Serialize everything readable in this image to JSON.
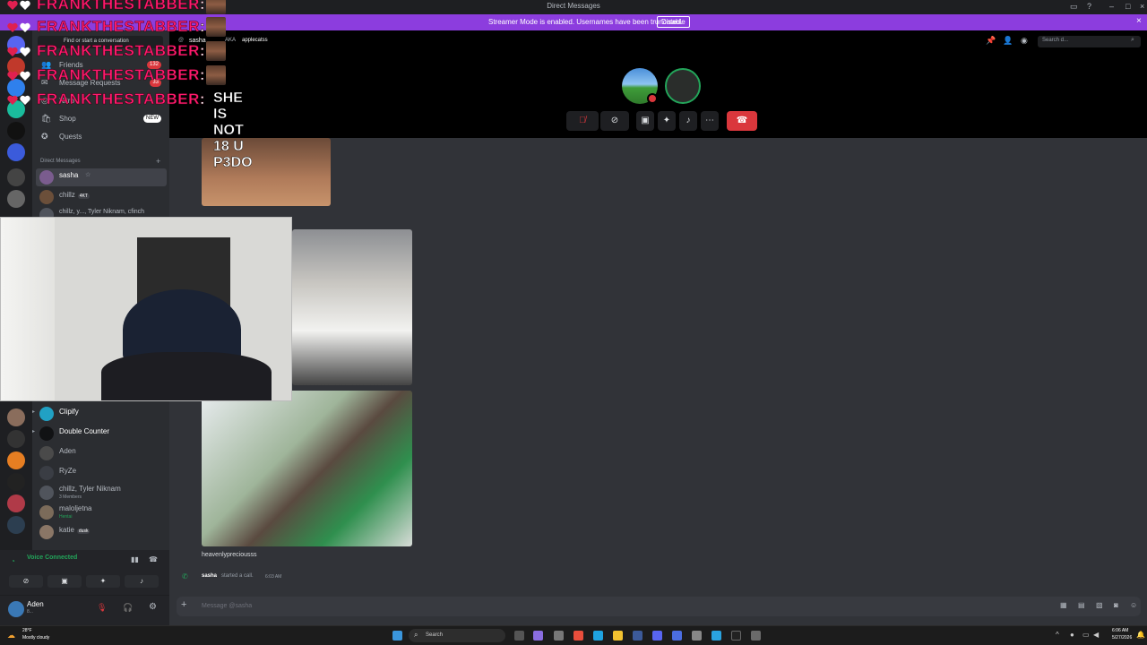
{
  "window": {
    "title": "Direct Messages"
  },
  "banner": {
    "message": "Streamer Mode is enabled. Usernames have been truncated.",
    "disable_label": "Disable"
  },
  "sidebar": {
    "find_placeholder": "Find or start a conversation",
    "nav": [
      {
        "label": "Friends",
        "badge": "132"
      },
      {
        "label": "Message Requests",
        "badge": "33"
      },
      {
        "label": "Nitro",
        "badge": ""
      },
      {
        "label": "Shop",
        "badge": "NEW"
      },
      {
        "label": "Quests",
        "badge": ""
      }
    ],
    "dm_header": "Direct Messages",
    "dms_top": [
      {
        "name": "sasha",
        "sub": "",
        "tag": "",
        "color": "#7a5c8e"
      },
      {
        "name": "chillz",
        "sub": "",
        "tag": "4KT",
        "color": "#6b4f3a"
      },
      {
        "name": "chillz, y..., Tyler Niknam, cfinch",
        "sub": "",
        "tag": "",
        "color": "#50545c"
      }
    ],
    "dms_bottom": [
      {
        "name": "Clipify",
        "sub": "",
        "tag": "",
        "color": "#21a1c4"
      },
      {
        "name": "Double Counter",
        "sub": "",
        "tag": "",
        "color": "#111214"
      },
      {
        "name": "Aden",
        "sub": "",
        "tag": "",
        "color": "#4a4a4a"
      },
      {
        "name": "RyZe",
        "sub": "",
        "tag": "",
        "color": "#3a3d44"
      },
      {
        "name": "chillz, Tyler Niknam",
        "sub": "3 Members",
        "tag": "",
        "color": "#50545c"
      },
      {
        "name": "maloljetna",
        "sub": "Hentai",
        "tag": "",
        "color": "#7b6b5a"
      },
      {
        "name": "katie",
        "sub": "",
        "tag": "dusk",
        "color": "#8a7666"
      }
    ]
  },
  "voice": {
    "status": "Voice Connected"
  },
  "user": {
    "name": "Aden",
    "status": "8..."
  },
  "call_header": {
    "channel": "sasha",
    "aka_label": "AKA",
    "aka_value": "applecatss",
    "search_placeholder": "Search d..."
  },
  "chat": {
    "video_caption": "heavenlypreciousss",
    "call_user": "sasha",
    "call_text": "started a call.",
    "call_time": "6:03 AM",
    "input_placeholder": "Message @sasha"
  },
  "overlay": {
    "username": "FRANKTHESTABBER",
    "separator": ":",
    "message": "SHE IS NOT 18 U P3DO"
  },
  "taskbar": {
    "temp": "28°F",
    "weather": "Mostly cloudy",
    "search": "Search",
    "time": "6:06 AM",
    "date": "5/27/2026"
  },
  "colors": {
    "accent": "#5865f2",
    "banner": "#8c3dde",
    "danger": "#da373c",
    "online": "#23a55a",
    "overlay_name": "#ff1a6e"
  }
}
